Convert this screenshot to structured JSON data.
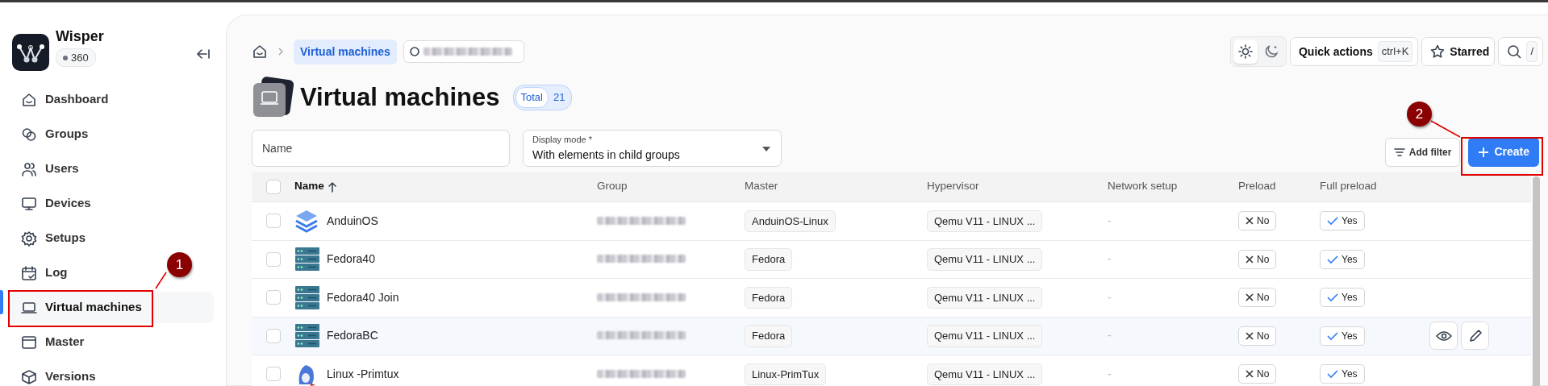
{
  "app": {
    "name": "Wisper",
    "version": "360"
  },
  "sidebar": {
    "items": [
      {
        "label": "Dashboard",
        "kind": "home",
        "selected": false
      },
      {
        "label": "Groups",
        "kind": "groups",
        "selected": false
      },
      {
        "label": "Users",
        "kind": "users",
        "selected": false
      },
      {
        "label": "Devices",
        "kind": "monitor",
        "selected": false
      },
      {
        "label": "Setups",
        "kind": "gear",
        "selected": false
      },
      {
        "label": "Log",
        "kind": "calendar",
        "selected": false
      },
      {
        "label": "Virtual machines",
        "kind": "laptop",
        "selected": true
      },
      {
        "label": "Master",
        "kind": "window",
        "selected": false
      },
      {
        "label": "Versions",
        "kind": "box",
        "selected": false
      }
    ]
  },
  "breadcrumb": {
    "current": "Virtual machines"
  },
  "header": {
    "quick_actions": "Quick actions",
    "quick_shortcut": "ctrl+K",
    "starred": "Starred",
    "search_shortcut": "/",
    "dark_mode": false
  },
  "page": {
    "title": "Virtual machines",
    "total_label": "Total",
    "total": "21"
  },
  "filters": {
    "name": {
      "placeholder": "Name"
    },
    "display_mode": {
      "label": "Display mode *",
      "value": "With elements in child groups"
    },
    "add_filter": "Add filter",
    "create": "Create"
  },
  "table": {
    "columns": [
      "Name",
      "Group",
      "Master",
      "Hypervisor",
      "Network setup",
      "Preload",
      "Full preload"
    ],
    "sorted_ascending": true,
    "all_checked": false,
    "rows": [
      {
        "name": "AnduinOS",
        "kind": "layers",
        "master": "AnduinOS-Linux",
        "hypervisor": "Qemu V11 - LINUX ...",
        "network": "-",
        "preload": {
          "label": "No",
          "on": false
        },
        "full_preload": {
          "label": "Yes",
          "on": true
        },
        "checked": false,
        "hovered": false
      },
      {
        "name": "Fedora40",
        "kind": "server",
        "master": "Fedora",
        "hypervisor": "Qemu V11 - LINUX ...",
        "network": "-",
        "preload": {
          "label": "No",
          "on": false
        },
        "full_preload": {
          "label": "Yes",
          "on": true
        },
        "checked": false,
        "hovered": false
      },
      {
        "name": "Fedora40 Join",
        "kind": "server",
        "master": "Fedora",
        "hypervisor": "Qemu V11 - LINUX ...",
        "network": "-",
        "preload": {
          "label": "No",
          "on": false
        },
        "full_preload": {
          "label": "Yes",
          "on": true
        },
        "checked": false,
        "hovered": false
      },
      {
        "name": "FedoraBC",
        "kind": "server",
        "master": "Fedora",
        "hypervisor": "Qemu V11 - LINUX ...",
        "network": "-",
        "preload": {
          "label": "No",
          "on": false
        },
        "full_preload": {
          "label": "Yes",
          "on": true
        },
        "checked": false,
        "hovered": true
      },
      {
        "name": "Linux -Primtux",
        "kind": "mascot",
        "master": "Linux-PrimTux",
        "hypervisor": "Qemu V11 - LINUX ...",
        "network": "-",
        "preload": {
          "label": "No",
          "on": false
        },
        "full_preload": {
          "label": "Yes",
          "on": true
        },
        "checked": false,
        "hovered": false
      }
    ]
  },
  "annotations": [
    {
      "label": "1"
    },
    {
      "label": "2"
    }
  ]
}
